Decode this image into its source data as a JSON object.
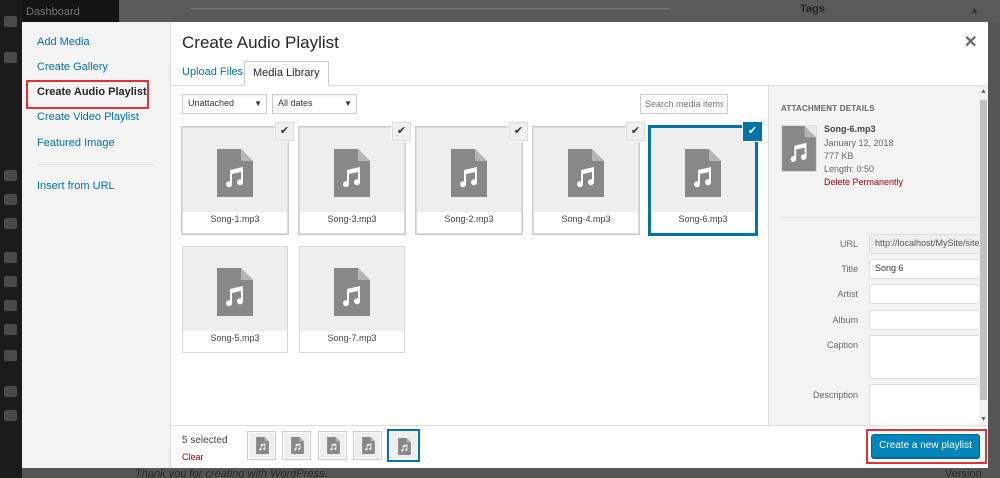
{
  "colors": {
    "accent": "#0073aa",
    "primary_button": "#0085ba",
    "highlight": "#e03236",
    "delete": "#a00"
  },
  "backdrop": {
    "menu_top": "Dashboard",
    "right_heading": "Tags",
    "footer_left": "Thank you for creating with WordPress.",
    "footer_right": "Version 4.9"
  },
  "modal": {
    "title": "Create Audio Playlist",
    "close_icon": "close-icon"
  },
  "menu": {
    "items": [
      {
        "label": "Add Media"
      },
      {
        "label": "Create Gallery"
      },
      {
        "label": "Create Audio Playlist",
        "active": true
      },
      {
        "label": "Create Video Playlist"
      },
      {
        "label": "Featured Image"
      },
      {
        "label": "Insert from URL"
      }
    ]
  },
  "tabs": {
    "upload": "Upload Files",
    "library": "Media Library"
  },
  "filters": {
    "type_selected": "Unattached",
    "date_selected": "All dates",
    "search_placeholder": "Search media items..."
  },
  "grid": {
    "items": [
      {
        "filename": "Song-1.mp3",
        "selected": true
      },
      {
        "filename": "Song-3.mp3",
        "selected": true
      },
      {
        "filename": "Song-2.mp3",
        "selected": true
      },
      {
        "filename": "Song-4.mp3",
        "selected": true
      },
      {
        "filename": "Song-6.mp3",
        "selected": true,
        "focused": true
      },
      {
        "filename": "Song-5.mp3",
        "selected": false
      },
      {
        "filename": "Song-7.mp3",
        "selected": false
      }
    ]
  },
  "details": {
    "heading": "ATTACHMENT DETAILS",
    "filename": "Song-6.mp3",
    "date": "January 12, 2018",
    "size": "777 KB",
    "length": "Length: 0:50",
    "delete": "Delete Permanently",
    "fields": {
      "url_label": "URL",
      "url_value": "http://localhost/MySite/site",
      "title_label": "Title",
      "title_value": "Song 6",
      "artist_label": "Artist",
      "artist_value": "",
      "album_label": "Album",
      "album_value": "",
      "caption_label": "Caption",
      "description_label": "Description"
    }
  },
  "toolbar": {
    "selected_count": "5 selected",
    "clear": "Clear",
    "create_button": "Create a new playlist"
  }
}
